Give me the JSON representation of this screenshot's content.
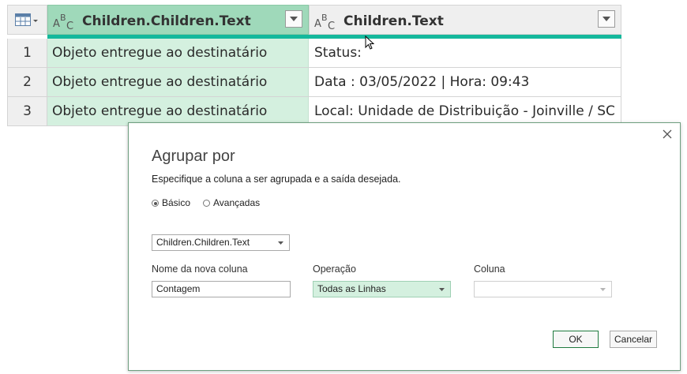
{
  "grid": {
    "columns": [
      {
        "name": "Children.Children.Text",
        "type_icon": "text-type-icon"
      },
      {
        "name": "Children.Text",
        "type_icon": "text-type-icon"
      }
    ],
    "rows": [
      {
        "index": "1",
        "col1": "Objeto entregue ao destinatário",
        "col2": "Status:"
      },
      {
        "index": "2",
        "col1": "Objeto entregue ao destinatário",
        "col2": "Data  : 03/05/2022 | Hora: 09:43"
      },
      {
        "index": "3",
        "col1": "Objeto entregue ao destinatário",
        "col2": "Local: Unidade de Distribuição - Joinville / SC"
      }
    ],
    "colors": {
      "selected_header": "#9fd9ba",
      "selected_cells": "#d4f0df",
      "quality_bar": "#14b89c"
    }
  },
  "dialog": {
    "title": "Agrupar por",
    "description": "Especifique a coluna a ser agrupada e a saída desejada.",
    "mode_basic": "Básico",
    "mode_advanced": "Avançadas",
    "mode_selected": "basic",
    "group_by_value": "Children.Children.Text",
    "new_column_label": "Nome da nova coluna",
    "new_column_value": "Contagem",
    "operation_label": "Operação",
    "operation_value": "Todas as Linhas",
    "column_label": "Coluna",
    "column_value": "",
    "ok_label": "OK",
    "cancel_label": "Cancelar",
    "accent": "#1f7a3f"
  }
}
